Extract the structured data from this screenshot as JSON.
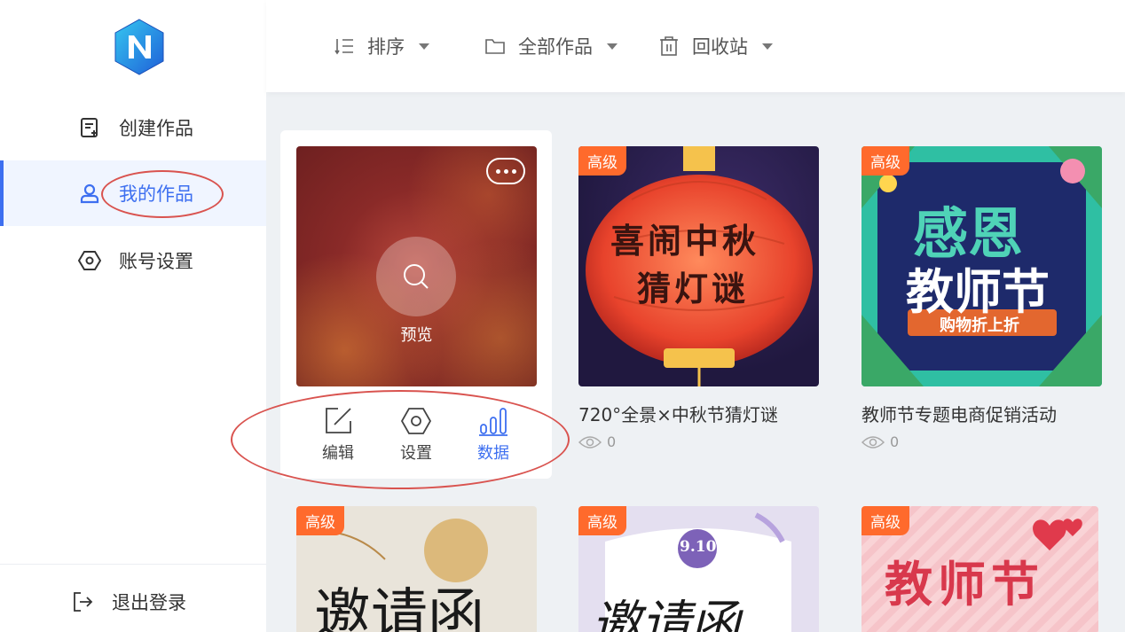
{
  "sidebar": {
    "items": [
      {
        "label": "创建作品",
        "icon": "edit-doc-icon"
      },
      {
        "label": "我的作品",
        "icon": "user-icon",
        "active": true
      },
      {
        "label": "账号设置",
        "icon": "hex-settings-icon"
      }
    ],
    "logout_label": "退出登录",
    "accent_color": "#3d6ff0"
  },
  "topbar": {
    "sort_label": "排序",
    "filter_label": "全部作品",
    "trash_label": "回收站"
  },
  "featured_card": {
    "preview_label": "预览",
    "actions": {
      "edit": "编辑",
      "settings": "设置",
      "data": "数据"
    }
  },
  "cards": [
    {
      "badge": "高级",
      "title": "720°全景×中秋节猜灯谜",
      "views": "0",
      "art_line1": "喜闹中秋",
      "art_line2": "猜灯谜"
    },
    {
      "badge": "高级",
      "title": "教师节专题电商促销活动",
      "views": "0",
      "art_line1": "感恩",
      "art_line2": "教师节",
      "art_ribbon": "购物折上折"
    },
    {
      "badge": "高级",
      "art_line1": "邀请函"
    },
    {
      "badge": "高级",
      "art_line1": "邀请函",
      "art_date": "9.10"
    },
    {
      "badge": "高级",
      "art_line1": "教师节"
    }
  ],
  "badge_color": "#ff6a2c",
  "annotation_color": "#d9534f"
}
